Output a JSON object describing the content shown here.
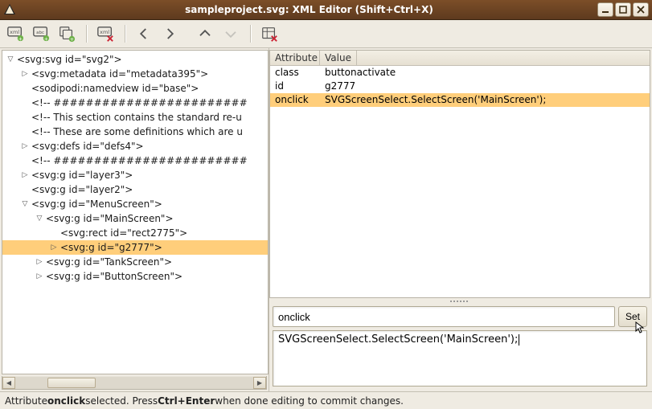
{
  "titlebar": {
    "title": "sampleproject.svg: XML Editor (Shift+Ctrl+X)"
  },
  "tree": {
    "rows": [
      {
        "depth": 0,
        "tri": "down",
        "text": "<svg:svg id=\"svg2\">",
        "sel": false
      },
      {
        "depth": 1,
        "tri": "right",
        "text": "<svg:metadata id=\"metadata395\">",
        "sel": false
      },
      {
        "depth": 1,
        "tri": "none",
        "text": "<sodipodi:namedview id=\"base\">",
        "sel": false
      },
      {
        "depth": 1,
        "tri": "none",
        "text": "<!-- ########################",
        "sel": false
      },
      {
        "depth": 1,
        "tri": "none",
        "text": "<!-- This section contains the standard re-u",
        "sel": false
      },
      {
        "depth": 1,
        "tri": "none",
        "text": "<!-- These are some definitions which are u",
        "sel": false
      },
      {
        "depth": 1,
        "tri": "right",
        "text": "<svg:defs id=\"defs4\">",
        "sel": false
      },
      {
        "depth": 1,
        "tri": "none",
        "text": "<!-- ########################",
        "sel": false
      },
      {
        "depth": 1,
        "tri": "right",
        "text": "<svg:g id=\"layer3\">",
        "sel": false
      },
      {
        "depth": 1,
        "tri": "none",
        "text": "<svg:g id=\"layer2\">",
        "sel": false
      },
      {
        "depth": 1,
        "tri": "down",
        "text": "<svg:g id=\"MenuScreen\">",
        "sel": false
      },
      {
        "depth": 2,
        "tri": "down",
        "text": "<svg:g id=\"MainScreen\">",
        "sel": false
      },
      {
        "depth": 3,
        "tri": "none",
        "text": "<svg:rect id=\"rect2775\">",
        "sel": false
      },
      {
        "depth": 3,
        "tri": "right",
        "text": "<svg:g id=\"g2777\">",
        "sel": true
      },
      {
        "depth": 2,
        "tri": "right",
        "text": "<svg:g id=\"TankScreen\">",
        "sel": false
      },
      {
        "depth": 2,
        "tri": "right",
        "text": "<svg:g id=\"ButtonScreen\">",
        "sel": false
      }
    ]
  },
  "attrs": {
    "header": {
      "col1": "Attribute",
      "col2": "Value"
    },
    "rows": [
      {
        "a": "class",
        "v": "buttonactivate",
        "sel": false
      },
      {
        "a": "id",
        "v": "g2777",
        "sel": false
      },
      {
        "a": "onclick",
        "v": "SVGScreenSelect.SelectScreen('MainScreen');",
        "sel": true
      }
    ]
  },
  "edit": {
    "attr_name": "onclick",
    "set_label": "Set",
    "attr_value": "SVGScreenSelect.SelectScreen('MainScreen');"
  },
  "status": {
    "prefix": "Attribute ",
    "strong1": "onclick",
    "mid": " selected. Press ",
    "strong2": "Ctrl+Enter",
    "suffix": " when done editing to commit changes."
  }
}
